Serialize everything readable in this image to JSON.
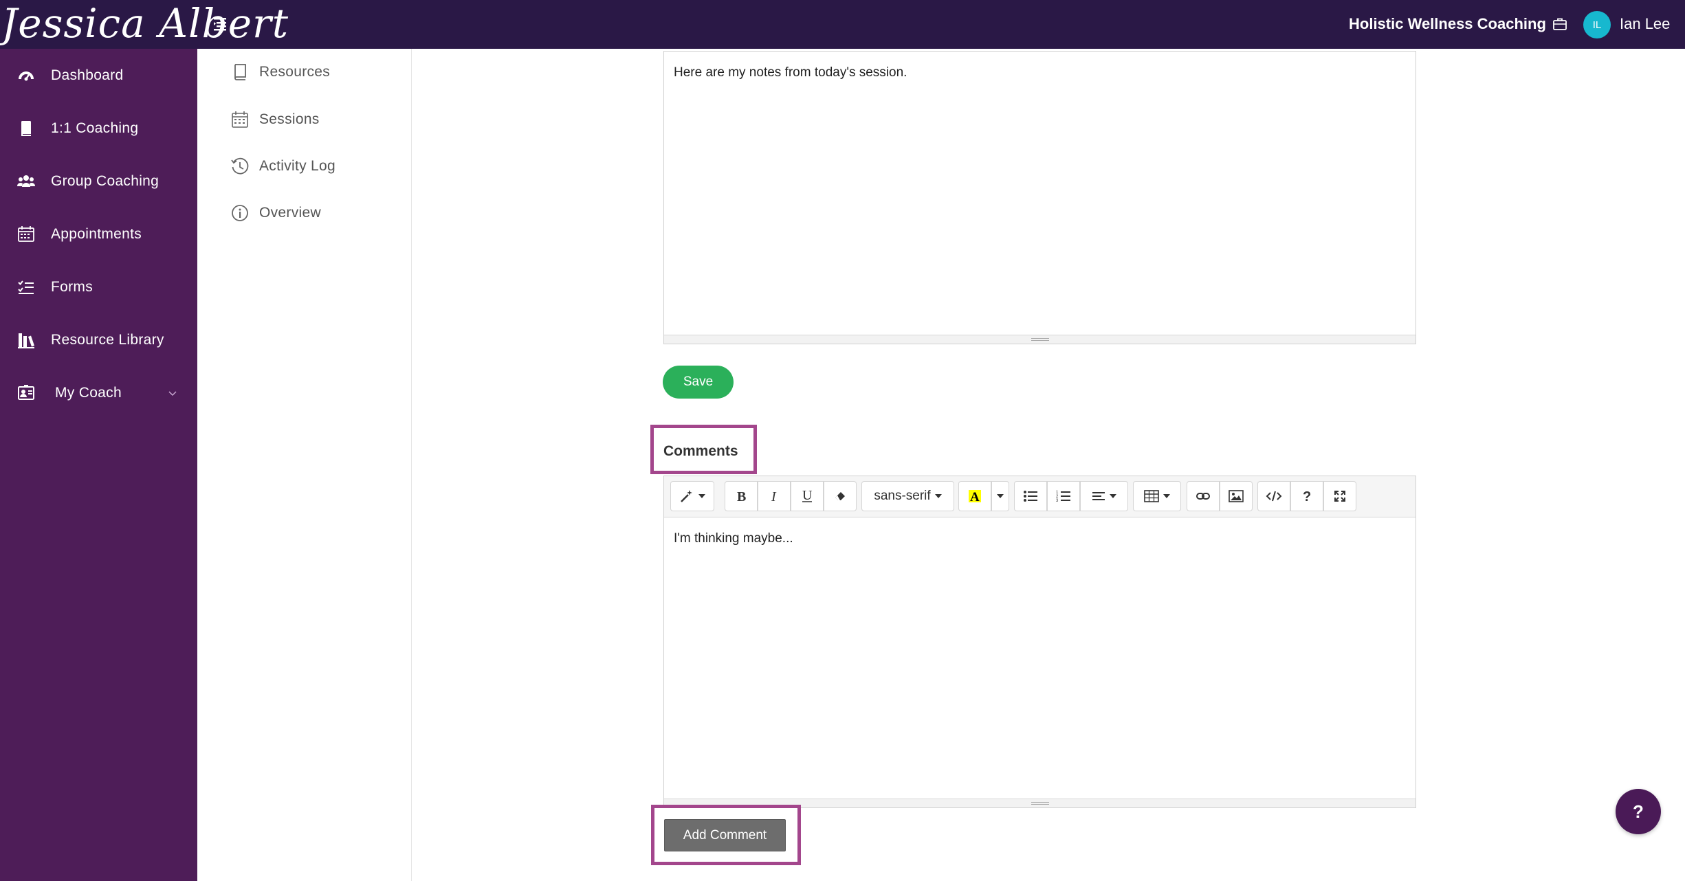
{
  "header": {
    "brand": "Jessica Albert",
    "org_name": "Holistic Wellness Coaching",
    "user_initials": "IL",
    "user_name": "Ian Lee"
  },
  "sidebar": {
    "items": [
      {
        "label": "Dashboard",
        "icon": "dashboard-icon"
      },
      {
        "label": "1:1 Coaching",
        "icon": "book-icon"
      },
      {
        "label": "Group Coaching",
        "icon": "users-icon"
      },
      {
        "label": "Appointments",
        "icon": "calendar-icon"
      },
      {
        "label": "Forms",
        "icon": "checklist-icon"
      },
      {
        "label": "Resource Library",
        "icon": "library-icon"
      },
      {
        "label": "My Coach",
        "icon": "coach-card-icon"
      }
    ]
  },
  "subnav": {
    "items": [
      {
        "label": "Resources",
        "icon": "book-outline-icon"
      },
      {
        "label": "Sessions",
        "icon": "calendar-outline-icon"
      },
      {
        "label": "Activity Log",
        "icon": "history-icon"
      },
      {
        "label": "Overview",
        "icon": "info-icon"
      }
    ]
  },
  "notes": {
    "text": "Here are my notes from today's session.",
    "save_label": "Save"
  },
  "comments": {
    "title": "Comments",
    "font_name": "sans-serif",
    "text": "I'm thinking maybe...",
    "add_label": "Add Comment"
  },
  "help": {
    "label": "?"
  },
  "colors": {
    "topbar": "#2a1846",
    "sidebar": "#4e1d58",
    "save_button": "#2bb05a",
    "highlight": "#a3468c",
    "avatar": "#17b8cf"
  }
}
